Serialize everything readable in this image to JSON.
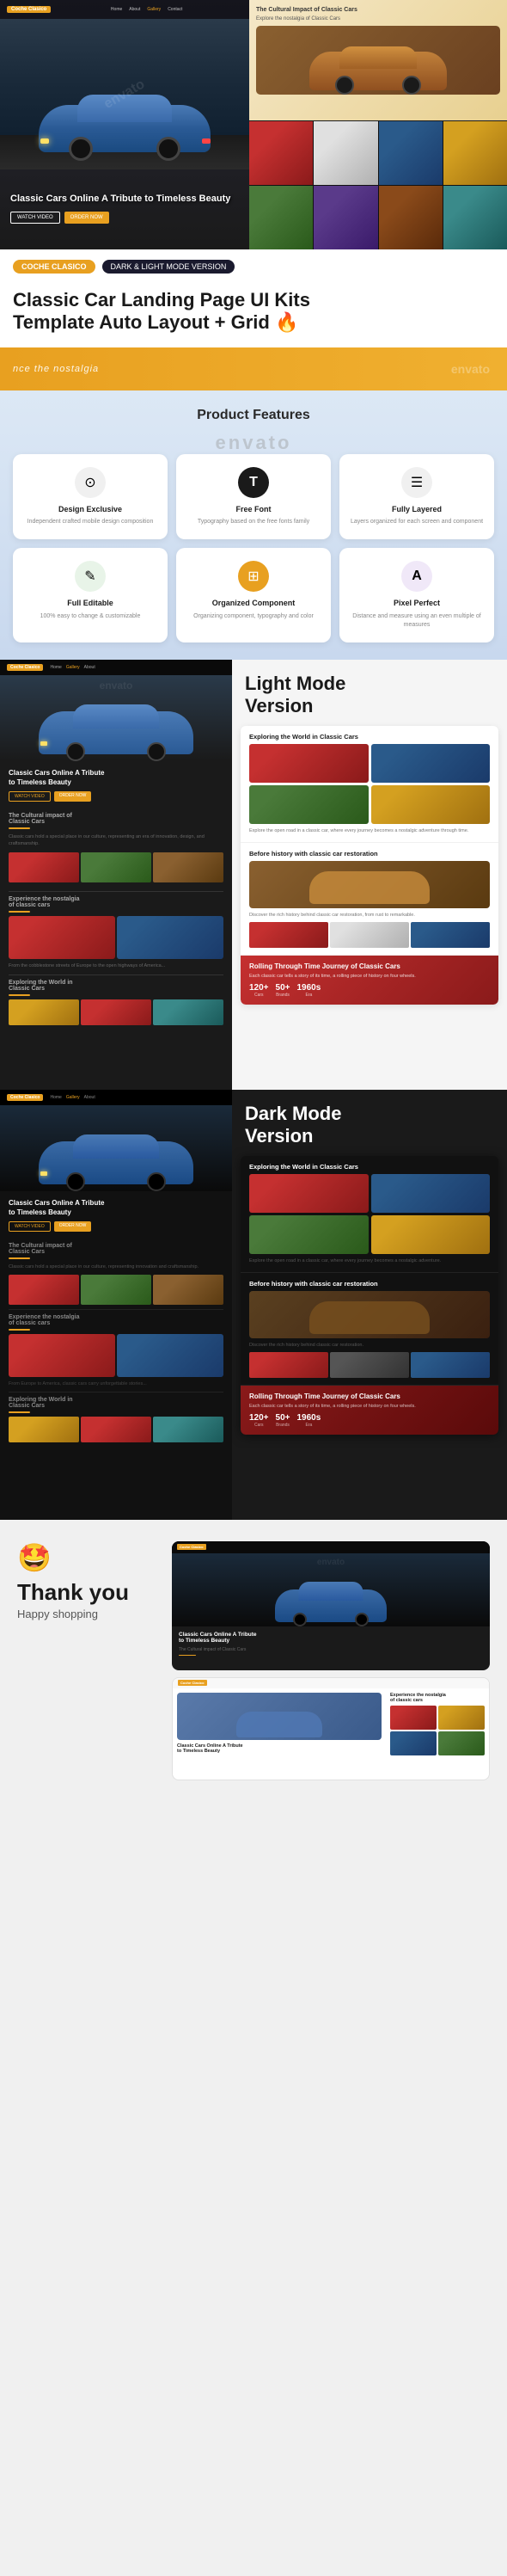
{
  "hero": {
    "title": "Classic Cars Online A Tribute to Timeless Beauty",
    "watch_btn": "WATCH VIDEO",
    "order_btn": "ORDER NOW",
    "right_top_title": "The Cultural Impact of Classic Cars"
  },
  "badges": {
    "tag1": "COCHE CLASICO",
    "tag2": "DARK & LIGHT MODE VERSION",
    "tagline": ""
  },
  "main_title": {
    "line1": "Classic Car Landing Page UI Kits",
    "line2": "Template Auto Layout + Grid",
    "fire": "🔥"
  },
  "preview_strip": {
    "text": "nce the nostalgia",
    "watermark": "envato"
  },
  "features": {
    "section_title": "Product Features",
    "watermark": "envato",
    "cards": [
      {
        "id": "design-exclusive",
        "icon": "⊙",
        "name": "Design Exclusive",
        "desc": "Independent crafted mobile design composition"
      },
      {
        "id": "free-font",
        "icon": "T",
        "name": "Free Font",
        "desc": "Typography based on the free fonts family"
      },
      {
        "id": "fully-layered",
        "icon": "≡",
        "name": "Fully Layered",
        "desc": "Layers organized for each screen and component"
      },
      {
        "id": "full-editable",
        "icon": "✎",
        "name": "Full Editable",
        "desc": "100% easy to change & customizable"
      },
      {
        "id": "organized-component",
        "icon": "⊞",
        "name": "Organized Component",
        "desc": "Organizing component, typography and color"
      },
      {
        "id": "pixel-perfect",
        "icon": "A",
        "name": "Pixel Perfect",
        "desc": "Distance and measure using an even multiple of measures"
      }
    ]
  },
  "light_mode": {
    "label": "Light Mode\nVersion",
    "hero_title": "Classic Cars Online A Tribute to Timeless Beauty",
    "section1": "Exploring the World in Classic Cars",
    "section2": "Before history with classic car restoration",
    "section3": "Rolling Through Time Journey of Classic Cars"
  },
  "dark_mode": {
    "label": "Dark Mode\nVersion",
    "hero_title": "Classic Cars Online A Tribute to Timeless Beauty",
    "section1": "Exploring the World in Classic Cars",
    "section2": "Before history with classic car restoration",
    "section3": "Rolling Through Time Journey of Classic Cars"
  },
  "thankyou": {
    "emoji": "🤩",
    "title": "Thank you",
    "subtitle": "Happy shopping"
  },
  "nav": {
    "logo": "Coche Clasico",
    "links": [
      "Home",
      "About",
      "Gallery",
      "Contact"
    ]
  },
  "watermark": "envato"
}
